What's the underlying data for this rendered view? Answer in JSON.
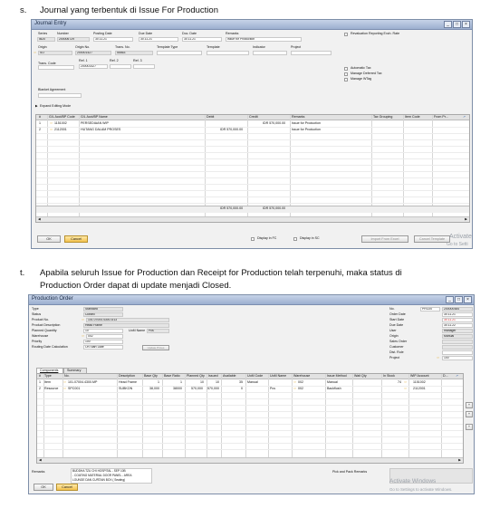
{
  "step_s": {
    "marker": "s.",
    "text": "Journal yang terbentuk di Issue For Production"
  },
  "step_t": {
    "marker": "t.",
    "text_line1": "Apabila seluruh Issue for Production dan Receipt for Production telah terpenuhi, maka status di",
    "text_line2": "Production Order dapat di update menjadi Closed."
  },
  "journal": {
    "title": "Journal Entry",
    "window_buttons": [
      "_",
      "□",
      "×"
    ],
    "header_labels": {
      "series": "Series",
      "number": "Number",
      "posting_date": "Posting Date",
      "due_date": "Due Date",
      "doc_date": "Doc. Date",
      "remarks": "Remarks"
    },
    "header_values": {
      "series": "IB20",
      "number": "200006729",
      "posting_date": "30.11.21",
      "due_date": "30.11.21",
      "doc_date": "30.11.21",
      "remarks": "Issue for Production"
    },
    "row2_labels": {
      "origin": "Origin",
      "origin_no": "Origin No.",
      "trans_no": "Trans. No.",
      "template_type": "Template Type",
      "template": "Template",
      "indicator": "Indicator",
      "project": "Project"
    },
    "row2_values": {
      "origin": "SO",
      "origin_no": "200001427",
      "trans_no": "55563"
    },
    "trans_code_label": "Trans. Code",
    "refs": {
      "ref1_label": "Ref. 1",
      "ref2_label": "Ref. 2",
      "ref3_label": "Ref. 3",
      "ref1_value": "200001427"
    },
    "blanket_label": "Blanket Agreement",
    "reval_label": "Revaluation Reporting Exch. Rate",
    "checks": [
      "Automatic Tax",
      "Manage Deferred Tax",
      "Manage WTag"
    ],
    "expand_label": "Expand Editing Mode",
    "columns": [
      "#",
      "G/L Acct/BP Code",
      "G/L Acct/BP Name",
      "Debit",
      "Credit",
      "Remarks",
      "Tax Grouping",
      "Item Code",
      "From Pr..."
    ],
    "rows": [
      {
        "num": "1",
        "code": "1151002",
        "name": "PERSEDIAAN WIP",
        "debit": "",
        "credit": "IDR 570,000.00",
        "remarks": "Issue for Production"
      },
      {
        "num": "2",
        "code": "2112001",
        "name": "HUTANG DALAM PROSES",
        "debit": "IDR 570,000.00",
        "credit": "",
        "remarks": "Issue for Production"
      }
    ],
    "total_debit": "IDR 570,000.00",
    "total_credit": "IDR 570,000.00",
    "ok_label": "OK",
    "cancel_label": "Cancel",
    "display_fc": "Display in FC",
    "display_sc": "Display in SC",
    "import_label": "Import From Excel",
    "cancel_template_label": "Cancel Template",
    "activate_fragment": "Activate",
    "go_settings_fragment": "Go to Setti"
  },
  "production": {
    "title": "Production Order",
    "window_buttons": [
      "_",
      "□",
      "×"
    ],
    "left_fields": [
      {
        "label": "Type",
        "value": "Standard"
      },
      {
        "label": "Status",
        "value": "Closed"
      },
      {
        "label": "Product No.",
        "value": "101.07004.4300.3/13"
      },
      {
        "label": "Product Description",
        "value": "Head Frame"
      },
      {
        "label": "Planned Quantity",
        "value": "10"
      },
      {
        "label": "Warehouse",
        "value": "002"
      },
      {
        "label": "Priority",
        "value": "100"
      },
      {
        "label": "Routing Date Calculation",
        "value": "On Start Date"
      }
    ],
    "uom_label": "UoM Name",
    "uom_value": "Pcs",
    "update_label": "Update Prices",
    "right_fields": [
      {
        "label": "No.",
        "series": "PRO20",
        "value": "200000484"
      },
      {
        "label": "Order Date",
        "value": "30.11.21"
      },
      {
        "label": "Start Date",
        "value": "30.11.21"
      },
      {
        "label": "Due Date",
        "value": "30.11.22"
      },
      {
        "label": "User",
        "value": "manager"
      },
      {
        "label": "Origin",
        "value": "Manual"
      },
      {
        "label": "Sales Order",
        "value": ""
      },
      {
        "label": "Customer",
        "value": ""
      },
      {
        "label": "Dist. Rule",
        "value": ""
      },
      {
        "label": "Project",
        "value": "100"
      }
    ],
    "tabs": [
      "Components",
      "Summary"
    ],
    "columns": [
      "#",
      "Type",
      "No.",
      "Description",
      "Base Qty",
      "Base Ratio",
      "Planned Qty",
      "Issued",
      "Available",
      "UoM Code",
      "UoM Name",
      "Warehouse",
      "Issue Method",
      "Wait Qty",
      "In Stock",
      "WIP Account",
      "D..."
    ],
    "rows": [
      {
        "num": "1",
        "type": "Item",
        "no": "101.07004.4300.MP",
        "desc": "Head Frame",
        "base_qty": "1",
        "base_ratio": "1",
        "planned": "10",
        "issued": "10",
        "available": "35",
        "uom_code": "Manual",
        "uom_name": "",
        "warehouse": "002",
        "method": "Manual",
        "instock": "74",
        "wip": "1151002"
      },
      {
        "num": "2",
        "type": "Resource",
        "no": "SPC001",
        "desc": "SUBKON",
        "base_qty": "38,000",
        "base_ratio": "38000",
        "planned": "570,000",
        "issued": "570,000",
        "available": "0",
        "uom_code": "",
        "uom_name": "Pcs",
        "warehouse": "002",
        "method": "Backflush",
        "instock": "",
        "wip": "2112001"
      }
    ],
    "remarks_label": "Remarks",
    "remarks_text": [
      "BUDDHA TZU CHI HOSPITAL - SEP 10B",
      "- COATING MATERIAL DOOR PANEL - AREA",
      "LOUNGE DAN CURTAIN BOX ( Seating)"
    ],
    "pick_label": "Pick and Pack Remarks",
    "ok_label": "OK",
    "cancel_label": "Cancel",
    "activate_text": "Activate Windows",
    "go_settings_text": "Go to Settings to activate Windows."
  }
}
